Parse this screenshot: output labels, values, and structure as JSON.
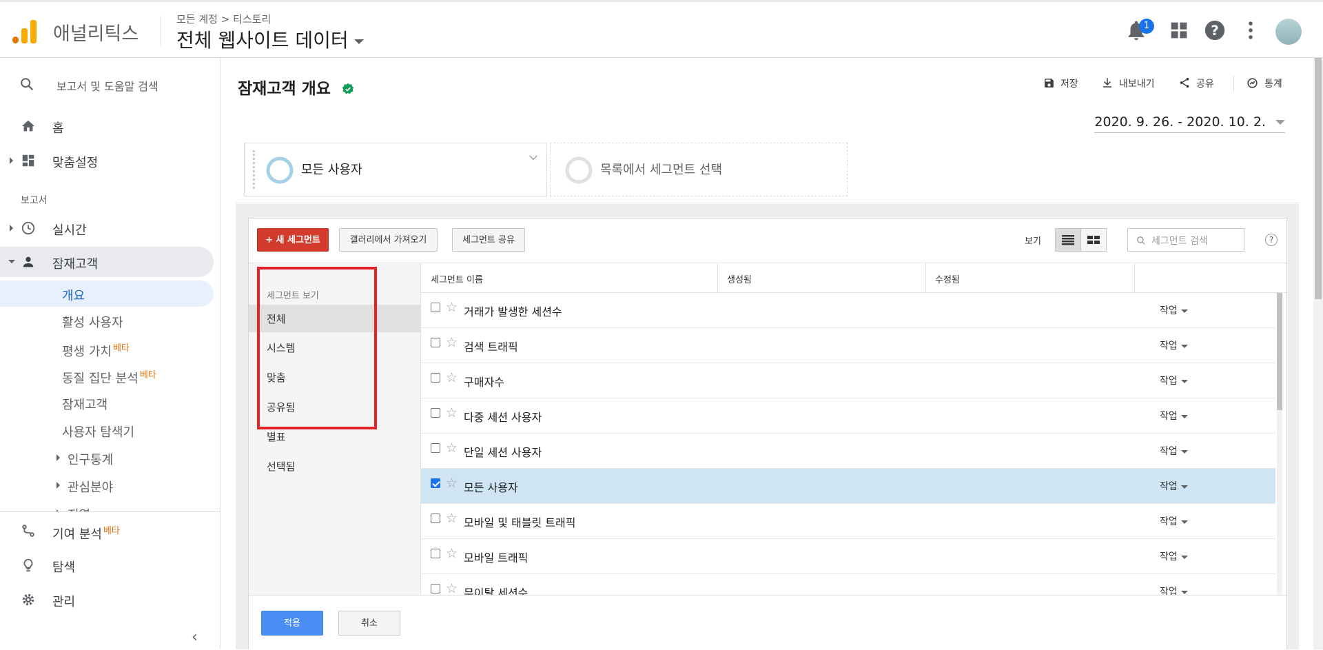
{
  "header": {
    "app_name": "애널리틱스",
    "breadcrumb": "모든 계정 > 티스토리",
    "property_title": "전체 웹사이트 데이터",
    "notification_count": "1"
  },
  "sidebar": {
    "search_placeholder": "보고서 및 도움말 검색",
    "home": "홈",
    "customization": "맞춤설정",
    "reports_label": "보고서",
    "realtime": "실시간",
    "audience": "잠재고객",
    "audience_sub": {
      "overview": "개요",
      "active_users": "활성 사용자",
      "lifetime_value": "평생 가치",
      "cohort": "동질 집단 분석",
      "audiences": "잠재고객",
      "user_explorer": "사용자 탐색기",
      "demographics": "인구통계",
      "interests": "관심분야",
      "geo": "지역"
    },
    "beta": "베타",
    "attribution": "기여 분석",
    "discover": "탐색",
    "admin": "관리"
  },
  "main": {
    "title": "잠재고객 개요",
    "actions": {
      "save": "저장",
      "export": "내보내기",
      "share": "공유",
      "insights": "통계"
    },
    "date_range": "2020. 9. 26. - 2020. 10. 2.",
    "segment_all_users": "모든 사용자",
    "segment_choose": "목록에서 세그먼트 선택"
  },
  "panel": {
    "new_segment": "+ 새 세그먼트",
    "import_gallery": "갤러리에서 가져오기",
    "share_segment": "세그먼트 공유",
    "view_label": "보기",
    "search_placeholder": "세그먼트 검색",
    "help": "?",
    "category_header": "세그먼트 보기",
    "categories": [
      "전체",
      "시스템",
      "맞춤",
      "공유됨",
      "별표",
      "선택됨"
    ],
    "columns": {
      "name": "세그먼트 이름",
      "created": "생성됨",
      "modified": "수정됨"
    },
    "action_label": "작업",
    "rows": [
      {
        "name": "거래가 발생한 세션수",
        "checked": false
      },
      {
        "name": "검색 트래픽",
        "checked": false
      },
      {
        "name": "구매자수",
        "checked": false
      },
      {
        "name": "다중 세션 사용자",
        "checked": false
      },
      {
        "name": "단일 세션 사용자",
        "checked": false
      },
      {
        "name": "모든 사용자",
        "checked": true
      },
      {
        "name": "모바일 및 태블릿 트래픽",
        "checked": false
      },
      {
        "name": "모바일 트래픽",
        "checked": false
      },
      {
        "name": "무이탈 세션수",
        "checked": false
      }
    ],
    "apply": "적용",
    "cancel": "취소"
  },
  "colors": {
    "accent_blue": "#1a73e8",
    "new_segment_red": "#d33b2c",
    "highlight_box_red": "#e4202b",
    "selected_row_bg": "#cfe5f3",
    "beta_orange": "#e8710a",
    "logo_orange": "#f9ab00",
    "verified_green": "#0f9d58"
  }
}
